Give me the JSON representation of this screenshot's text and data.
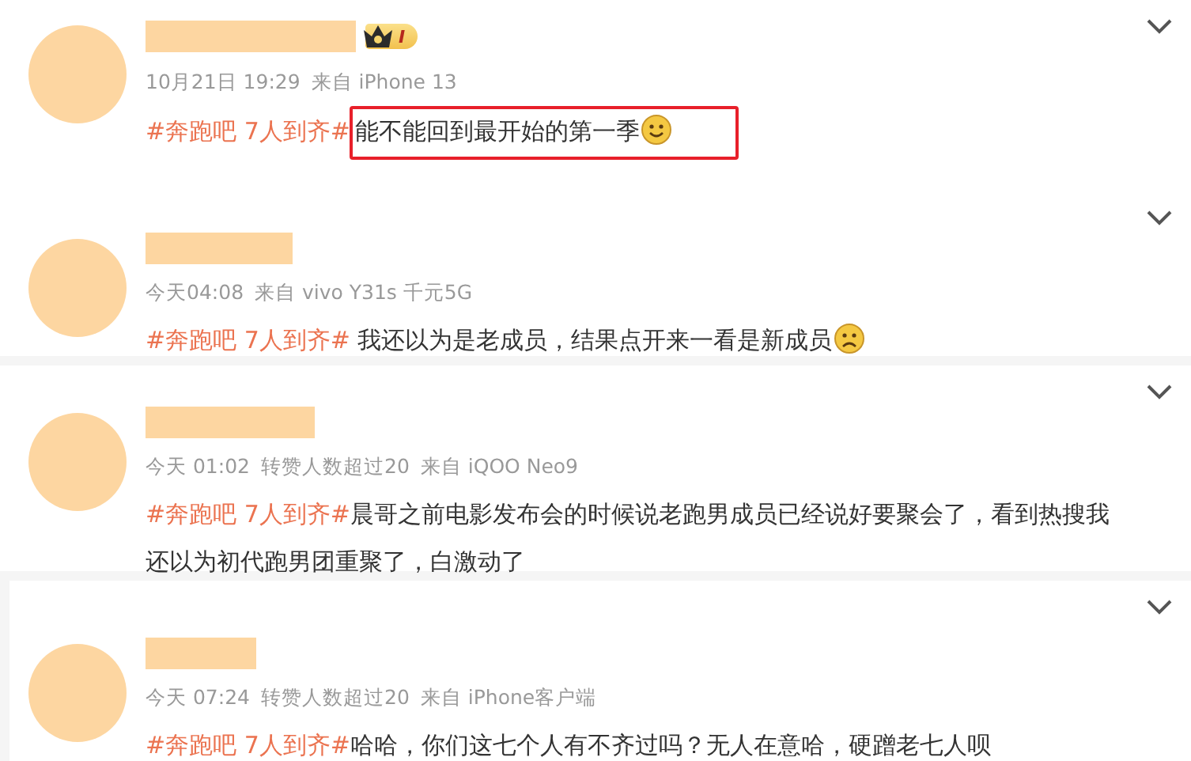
{
  "posts": [
    {
      "badge": "I",
      "highlighted": true,
      "time": "10月21日 19:29",
      "source": "来自 iPhone 13",
      "hashtag": "#奔跑吧 7人到齐#",
      "body": "能不能回到最开始的第一季",
      "emoji": {
        "kind": "smile"
      }
    },
    {
      "highlighted": false,
      "time": "今天04:08",
      "source": "来自 vivo Y31s 千元5G",
      "hashtag": "#奔跑吧 7人到齐#",
      "body": " 我还以为是老成员，结果点开来一看是新成员",
      "emoji": {
        "kind": "sad"
      }
    },
    {
      "highlighted": false,
      "time": "今天 01:02",
      "note": "转赞人数超过20",
      "source": "来自 iQOO Neo9",
      "hashtag": "#奔跑吧 7人到齐#",
      "body": "晨哥之前电影发布会的时候说老跑男成员已经说好要聚会了，看到热搜我还以为初代跑男团重聚了，白激动了"
    },
    {
      "highlighted": false,
      "time": "今天 07:24",
      "note": "转赞人数超过20",
      "source": "来自 iPhone客户端",
      "hashtag": "#奔跑吧 7人到齐#",
      "body": "哈哈，你们这七个人有不齐过吗？无人在意哈，硬蹭老七人呗"
    }
  ]
}
